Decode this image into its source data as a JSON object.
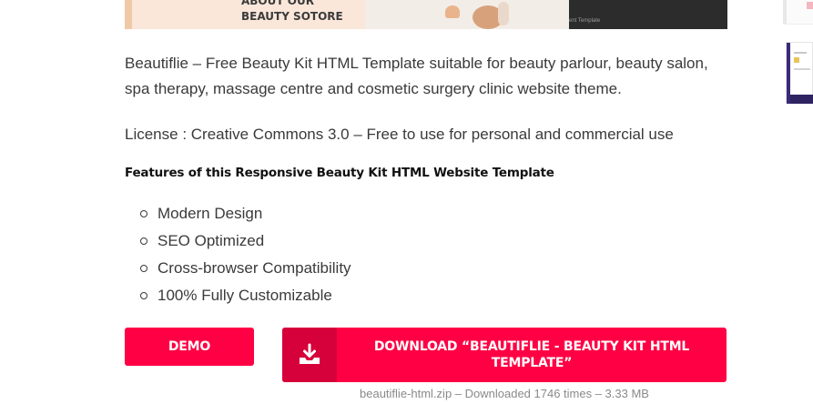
{
  "hero": {
    "about_label": "ABOUT OUR\nBEAUTY SOTORE",
    "small_text": "ent Template"
  },
  "content": {
    "description": "Beautiflie – Free Beauty Kit HTML Template suitable for beauty parlour, beauty salon, spa therapy, massage centre and cosmetic surgery clinic website theme.",
    "license": "License : Creative Commons 3.0 – Free to use for personal and commercial use",
    "features_title": "Features of this Responsive Beauty Kit HTML Website Template",
    "features": [
      "Modern Design",
      "SEO Optimized",
      "Cross-browser Compatibility",
      "100% Fully Customizable"
    ]
  },
  "buttons": {
    "demo_label": "DEMO",
    "download_label": "DOWNLOAD “BEAUTIFLIE - BEAUTY KIT HTML TEMPLATE”",
    "download_meta": "beautiflie-html.zip – Downloaded 1746 times – 3.33 MB",
    "download_icon": "download-tray-icon"
  },
  "colors": {
    "accent": "#ff0044",
    "accent_dark": "#d6003a",
    "text": "#3a3a3a",
    "meta": "#8a8a8a"
  }
}
